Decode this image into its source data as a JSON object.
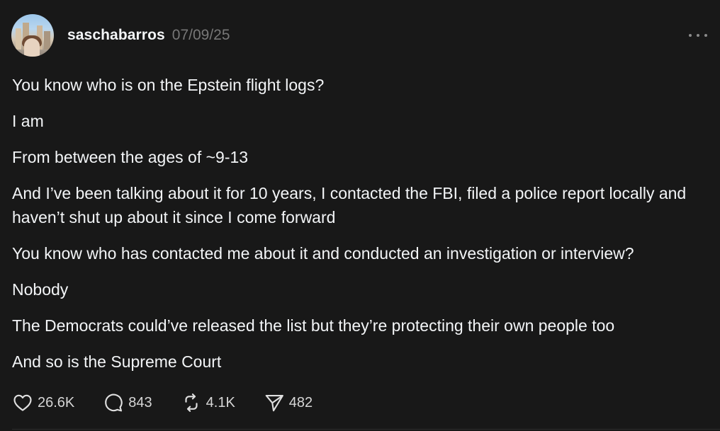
{
  "post": {
    "username": "saschabarros",
    "date": "07/09/25",
    "paragraphs": [
      "You know who is on the Epstein flight logs?",
      "I am",
      "From between the ages of ~9-13",
      "And I’ve been talking about it for 10 years, I contacted the FBI, filed a police report locally and haven’t shut up about it since I come forward",
      "You know who has contacted me about it and conducted an investigation or interview?",
      "Nobody",
      "The Democrats could’ve released the list but they’re protecting their own people too",
      "And so is the Supreme Court"
    ],
    "actions": {
      "likes": "26.6K",
      "replies": "843",
      "reposts": "4.1K",
      "shares": "482"
    }
  },
  "colors": {
    "background": "#181818",
    "text": "#f3f5f7",
    "muted": "#777777"
  },
  "icons": {
    "like": "heart-icon",
    "reply": "speech-bubble-icon",
    "repost": "repost-icon",
    "share": "send-icon",
    "more": "more-dots-icon"
  }
}
